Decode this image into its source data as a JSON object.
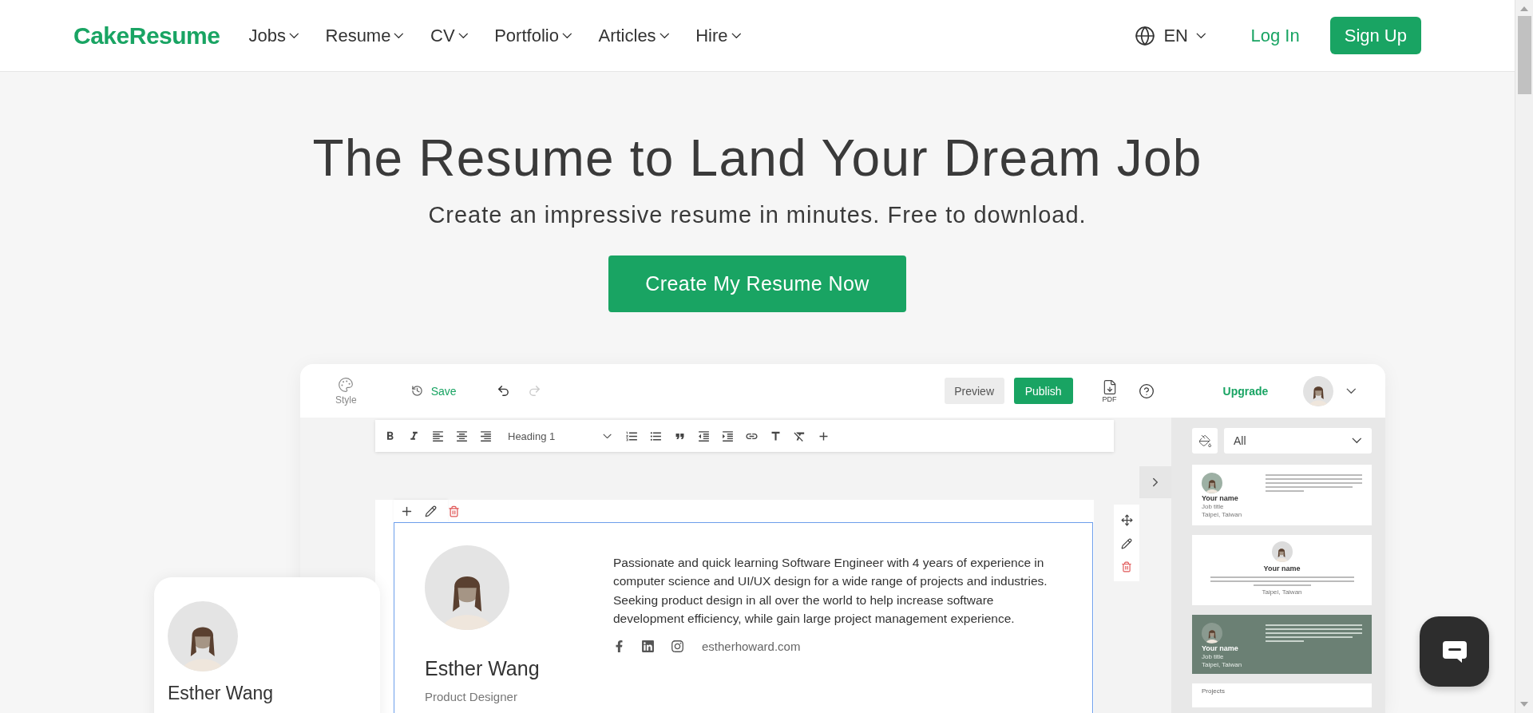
{
  "nav": {
    "logo": "CakeResume",
    "items": [
      {
        "label": "Jobs"
      },
      {
        "label": "Resume"
      },
      {
        "label": "CV"
      },
      {
        "label": "Portfolio"
      },
      {
        "label": "Articles"
      },
      {
        "label": "Hire"
      }
    ],
    "language": "EN",
    "login": "Log In",
    "signup": "Sign Up"
  },
  "hero": {
    "title": "The Resume to Land Your Dream Job",
    "subtitle": "Create an impressive resume in minutes. Free to download.",
    "cta": "Create My Resume Now"
  },
  "editor": {
    "style_label": "Style",
    "save": "Save",
    "preview": "Preview",
    "publish": "Publish",
    "pdf_label": "PDF",
    "upgrade": "Upgrade",
    "heading_select": "Heading 1",
    "filter": "All",
    "resume": {
      "name": "Esther Wang",
      "title": "Product Designer",
      "bio": "Passionate and quick learning Software Engineer with 4 years of experience in computer science and UI/UX design for a wide range of projects and industries. Seeking product design in all over the world to help increase software development efficiency, while gain large project management experience.",
      "website": "estherhoward.com"
    },
    "templates": [
      {
        "kind": "left",
        "name": "Your name",
        "job_title": "Job title",
        "location": "Taipei, Taiwan"
      },
      {
        "kind": "center",
        "name": "Your name",
        "location": "Taipei, Taiwan"
      },
      {
        "kind": "dark",
        "name": "Your name",
        "job_title": "Job title",
        "location": "Taipei, Taiwan"
      },
      {
        "kind": "section",
        "heading": "Projects"
      }
    ]
  },
  "profile_card": {
    "name": "Esther Wang"
  }
}
